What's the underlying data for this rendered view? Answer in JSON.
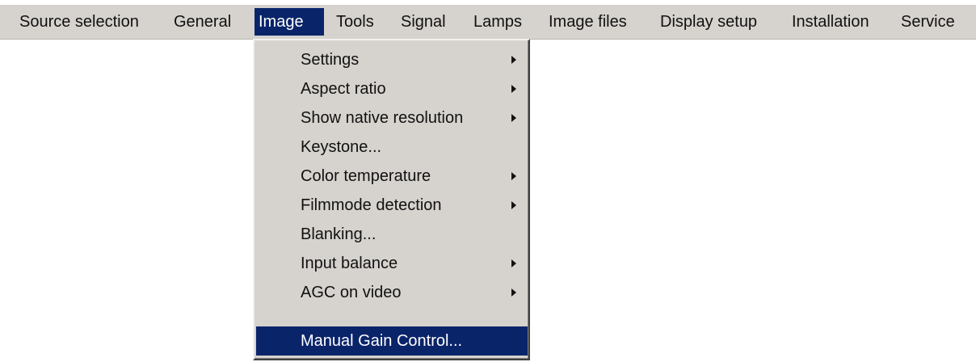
{
  "menubar": {
    "items": [
      {
        "label": "Source selection"
      },
      {
        "label": "General"
      },
      {
        "label": "Image",
        "active": true
      },
      {
        "label": "Tools"
      },
      {
        "label": "Signal"
      },
      {
        "label": "Lamps"
      },
      {
        "label": "Image files"
      },
      {
        "label": "Display setup"
      },
      {
        "label": "Installation"
      },
      {
        "label": "Service"
      }
    ]
  },
  "image_menu": {
    "items": [
      {
        "label": "Settings",
        "submenu": true
      },
      {
        "label": "Aspect ratio",
        "submenu": true
      },
      {
        "label": "Show native resolution",
        "submenu": true
      },
      {
        "label": "Keystone...",
        "submenu": false
      },
      {
        "label": "Color temperature",
        "submenu": true
      },
      {
        "label": "Filmmode detection",
        "submenu": true
      },
      {
        "label": "Blanking...",
        "submenu": false
      },
      {
        "label": "Input balance",
        "submenu": true
      },
      {
        "label": "AGC on video",
        "submenu": true
      },
      {
        "label": "Manual Gain Control...",
        "submenu": false,
        "highlighted": true
      }
    ]
  },
  "colors": {
    "menu_background": "#d6d3ce",
    "highlight": "#0a246a",
    "highlight_text": "#ffffff",
    "text": "#111111"
  },
  "icons": {
    "submenu_arrow": "submenu-arrow-icon"
  }
}
